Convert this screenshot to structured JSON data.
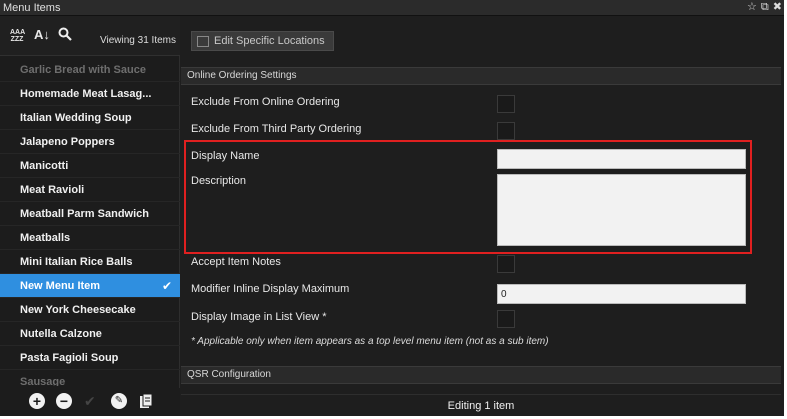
{
  "window": {
    "title": "Menu Items",
    "icons": [
      "star-icon",
      "restore-icon",
      "close-icon"
    ]
  },
  "sidebar": {
    "viewing_text": "Viewing 31 Items",
    "sort_aaa_label": "AAA\nZZZ",
    "sort_az_label": "A↓",
    "items": [
      {
        "label": "Garlic Bread with Sauce",
        "state": "faded"
      },
      {
        "label": "Homemade Meat Lasag...",
        "state": "normal"
      },
      {
        "label": "Italian Wedding Soup",
        "state": "normal"
      },
      {
        "label": "Jalapeno Poppers",
        "state": "normal"
      },
      {
        "label": "Manicotti",
        "state": "normal"
      },
      {
        "label": "Meat Ravioli",
        "state": "normal"
      },
      {
        "label": "Meatball Parm Sandwich",
        "state": "normal"
      },
      {
        "label": "Meatballs",
        "state": "normal"
      },
      {
        "label": "Mini Italian Rice Balls",
        "state": "normal"
      },
      {
        "label": "New Menu Item",
        "state": "selected"
      },
      {
        "label": "New York Cheesecake",
        "state": "normal"
      },
      {
        "label": "Nutella Calzone",
        "state": "normal"
      },
      {
        "label": "Pasta Fagioli Soup",
        "state": "normal"
      },
      {
        "label": "Sausage",
        "state": "faded"
      }
    ]
  },
  "main": {
    "edit_locations_label": "Edit Specific Locations",
    "online_section_title": "Online Ordering Settings",
    "fields": {
      "exclude_online": "Exclude From Online Ordering",
      "exclude_third_party": "Exclude From Third Party Ordering",
      "display_name": "Display Name",
      "description": "Description",
      "accept_notes": "Accept Item Notes",
      "modifier_max": "Modifier Inline Display Maximum",
      "display_image": "Display Image in List View *"
    },
    "modifier_max_value": "0",
    "note": "* Applicable only when item appears as a top level menu item (not as a sub item)",
    "qsr_section_title": "QSR Configuration",
    "status": "Editing 1 item"
  },
  "colors": {
    "selected": "#2f8fe0",
    "highlight": "#e02020",
    "background": "#1e1e1e"
  }
}
